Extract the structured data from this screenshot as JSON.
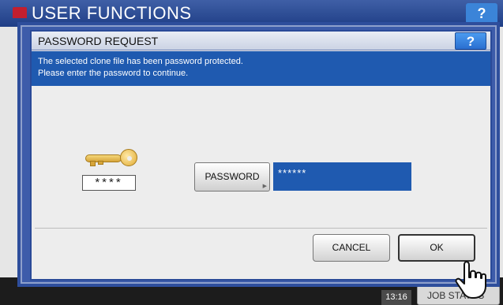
{
  "background": {
    "title": "USER FUNCTIONS",
    "help_label": "?",
    "time": "13:16",
    "job_status_label": "JOB STATUS"
  },
  "dialog": {
    "title": "PASSWORD REQUEST",
    "help_label": "?",
    "message_line1": "The selected clone file has been password protected.",
    "message_line2": "Please enter the password to continue.",
    "mask_text": "****",
    "password_button_label": "PASSWORD",
    "password_value": "******",
    "cancel_label": "CANCEL",
    "ok_label": "OK"
  },
  "colors": {
    "header_blue": "#1f3e86",
    "message_blue": "#1f5ab0",
    "help_blue": "#3b84d8"
  },
  "icons": [
    "home-icon",
    "key-icon",
    "hand-cursor-icon"
  ]
}
